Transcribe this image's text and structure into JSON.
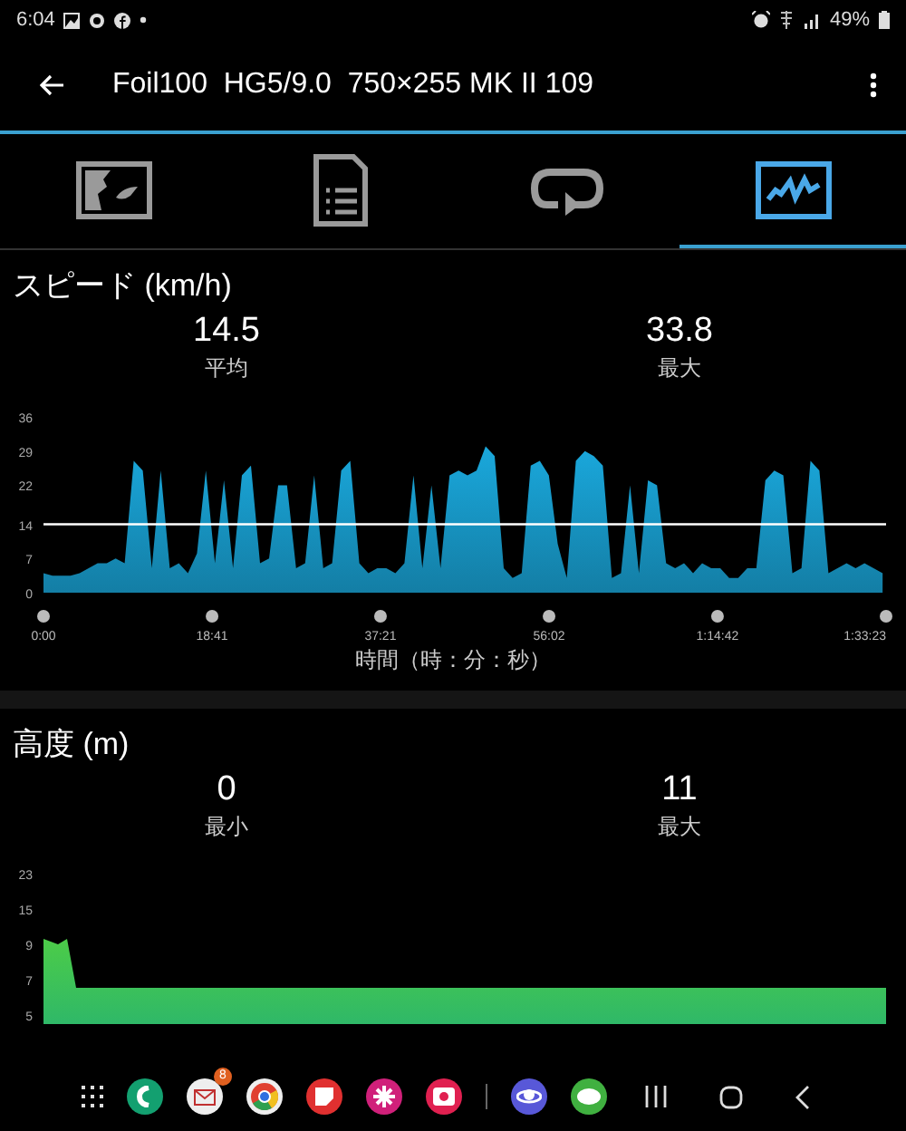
{
  "status_bar": {
    "time": "6:04",
    "battery": "49%"
  },
  "app_bar": {
    "title": "Foil100  HG5/9.0  750×255 MK II 109"
  },
  "tabs": [
    {
      "kind": "map",
      "selected": false
    },
    {
      "kind": "document",
      "selected": false
    },
    {
      "kind": "loop",
      "selected": false
    },
    {
      "kind": "chart",
      "selected": true
    }
  ],
  "speed": {
    "title": "スピード (km/h)",
    "stats": [
      {
        "value": "14.5",
        "label": "平均"
      },
      {
        "value": "33.8",
        "label": "最大"
      }
    ],
    "chart_data": {
      "type": "area",
      "xlabel": "時間（時：分：秒）",
      "xlim": [
        0,
        5603
      ],
      "ylim": [
        0,
        36
      ],
      "yticks": [
        0,
        7,
        14,
        22,
        29,
        36
      ],
      "xticks": [
        {
          "value": 0,
          "label": "0:00"
        },
        {
          "value": 1121,
          "label": "18:41"
        },
        {
          "value": 2241,
          "label": "37:21"
        },
        {
          "value": 3362,
          "label": "56:02"
        },
        {
          "value": 4482,
          "label": "1:14:42"
        },
        {
          "value": 5603,
          "label": "1:33:23"
        }
      ],
      "x": [
        0,
        60,
        120,
        180,
        240,
        300,
        360,
        420,
        480,
        540,
        600,
        660,
        720,
        780,
        840,
        900,
        960,
        1020,
        1080,
        1140,
        1200,
        1260,
        1320,
        1380,
        1440,
        1500,
        1560,
        1620,
        1680,
        1740,
        1800,
        1860,
        1920,
        1980,
        2040,
        2100,
        2160,
        2220,
        2280,
        2340,
        2400,
        2460,
        2520,
        2580,
        2640,
        2700,
        2760,
        2820,
        2880,
        2940,
        3000,
        3060,
        3120,
        3180,
        3240,
        3300,
        3360,
        3420,
        3480,
        3540,
        3600,
        3660,
        3720,
        3780,
        3840,
        3900,
        3960,
        4020,
        4080,
        4140,
        4200,
        4260,
        4320,
        4380,
        4440,
        4500,
        4560,
        4620,
        4680,
        4740,
        4800,
        4860,
        4920,
        4980,
        5040,
        5100,
        5160,
        5220,
        5280,
        5340,
        5400,
        5460,
        5520,
        5580
      ],
      "series": [
        {
          "color": "#1aa8dc",
          "values": [
            4,
            3.5,
            3.5,
            3.5,
            4,
            5,
            6,
            6,
            7,
            6,
            27,
            25,
            5,
            25,
            5,
            6,
            4,
            8,
            25,
            6,
            23,
            5,
            24,
            26,
            6,
            7,
            22,
            22,
            5,
            6,
            24,
            5,
            6,
            25,
            27,
            6,
            4,
            5,
            5,
            4,
            6,
            24,
            5,
            22,
            5,
            24,
            25,
            24,
            25,
            30,
            28,
            5,
            3,
            4,
            26,
            27,
            24,
            10,
            3,
            27,
            29,
            28,
            26,
            3,
            4,
            22,
            4,
            23,
            22,
            6,
            5,
            6,
            4,
            6,
            5,
            5,
            3,
            3,
            5,
            5,
            23,
            25,
            24,
            4,
            5,
            27,
            25,
            4,
            5,
            6,
            5,
            6,
            5,
            4
          ]
        }
      ]
    }
  },
  "altitude": {
    "title": "高度 (m)",
    "stats": [
      {
        "value": "0",
        "label": "最小"
      },
      {
        "value": "11",
        "label": "最大"
      }
    ],
    "axis_labels": [
      "23",
      "15",
      "9",
      "7",
      "5"
    ]
  },
  "dock": {
    "badge": "8"
  }
}
